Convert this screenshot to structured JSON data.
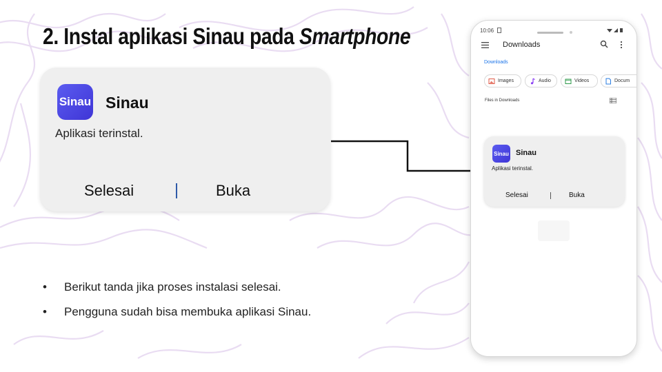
{
  "slide": {
    "title_main": "2. Instal aplikasi Sinau pada ",
    "title_emphasis": "Smartphone"
  },
  "dialog": {
    "app_icon_text": "Sinau",
    "app_name": "Sinau",
    "status": "Aplikasi terinstal.",
    "done_button": "Selesai",
    "open_button": "Buka"
  },
  "bullets": [
    "Berikut tanda jika proses instalasi selesai.",
    "Pengguna sudah bisa membuka aplikasi Sinau."
  ],
  "phone": {
    "time": "10:06",
    "appbar_title": "Downloads",
    "breadcrumb": "Downloads",
    "chips": [
      "Images",
      "Audio",
      "Videos",
      "Docum"
    ],
    "section_label": "Files in Downloads"
  },
  "colors": {
    "app_icon": "#4f46e5",
    "link_blue": "#1a73e8",
    "swirl": "#e6d6f0",
    "separator_blue": "#2e5aa8"
  },
  "icons": {
    "menu": "hamburger-icon",
    "search": "search-icon",
    "more": "more-vert-icon",
    "images": "image-icon",
    "audio": "music-note-icon",
    "videos": "video-icon",
    "documents": "document-icon",
    "list_view": "list-view-icon"
  }
}
